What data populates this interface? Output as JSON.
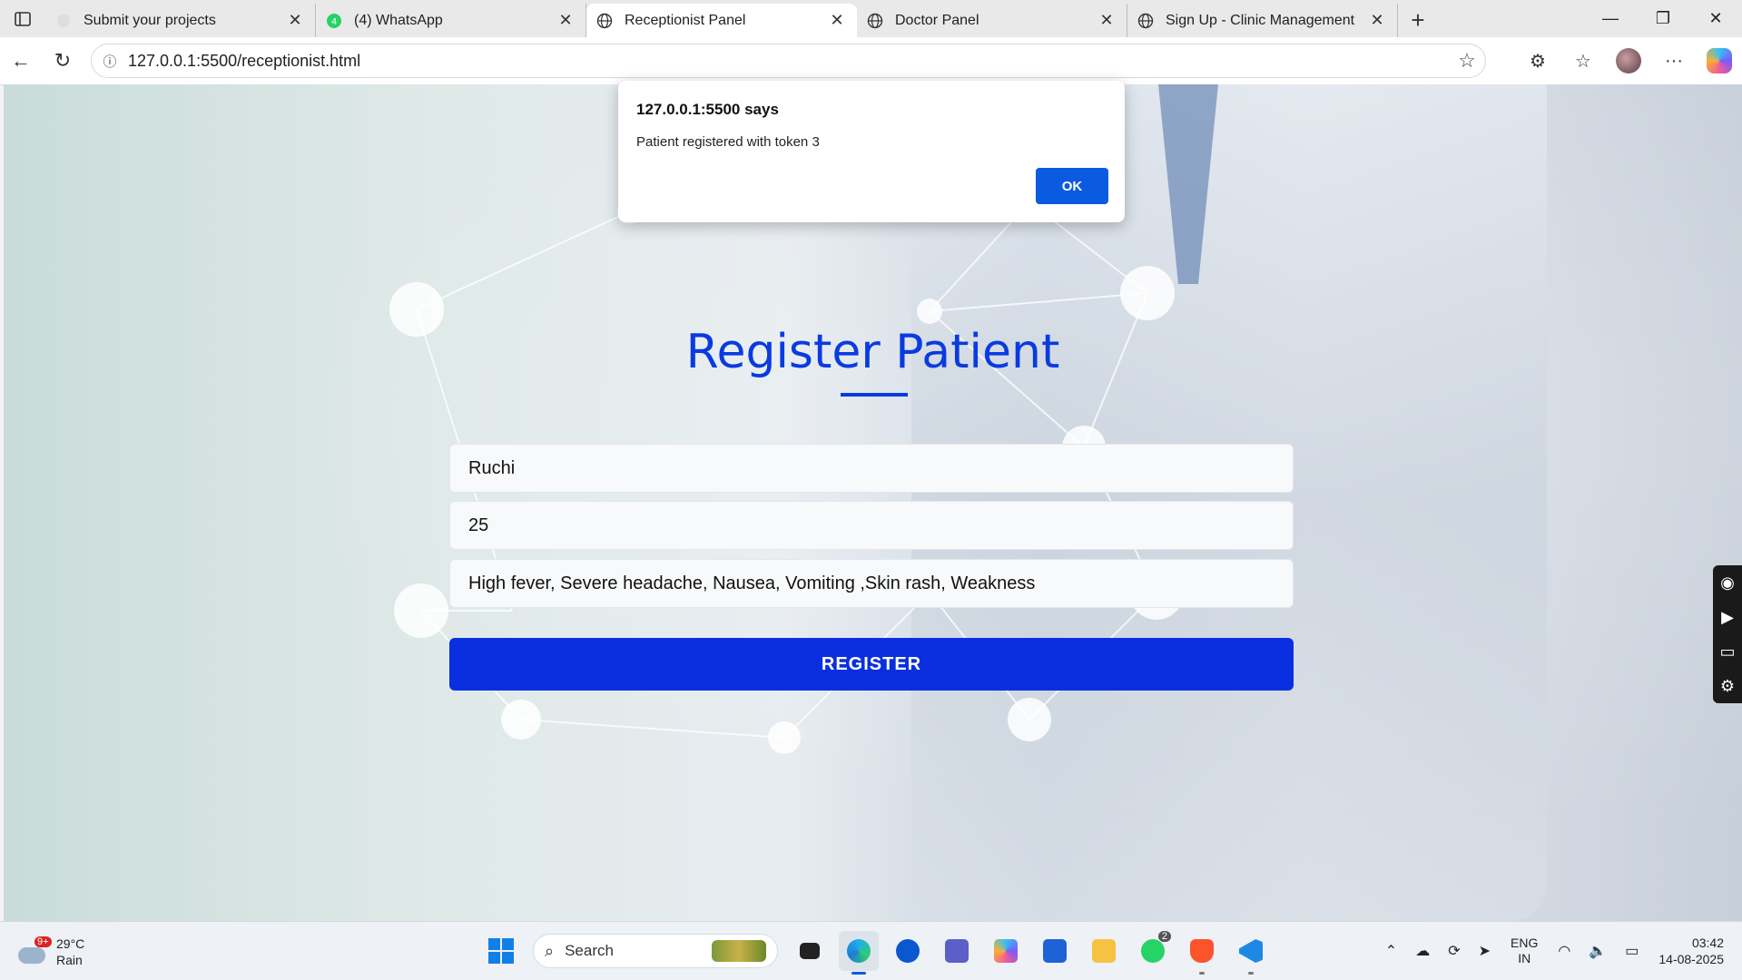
{
  "browser": {
    "tabs": [
      {
        "title": "Submit your projects",
        "active": false
      },
      {
        "title": "(4) WhatsApp",
        "active": false
      },
      {
        "title": "Receptionist Panel",
        "active": true
      },
      {
        "title": "Doctor Panel",
        "active": false
      },
      {
        "title": "Sign Up - Clinic Management",
        "active": false
      }
    ],
    "url": "127.0.0.1:5500/receptionist.html"
  },
  "alert": {
    "origin": "127.0.0.1:5500 says",
    "message": "Patient registered with token 3",
    "ok_label": "OK"
  },
  "form": {
    "heading": "Register Patient",
    "name_value": "Ruchi",
    "age_value": "25",
    "symptoms_value": "High fever, Severe headache, Nausea, Vomiting ,Skin rash, Weakness",
    "register_label": "REGISTER"
  },
  "taskbar": {
    "temperature": "29°C",
    "condition": "Rain",
    "weather_badge": "9+",
    "search_placeholder": "Search",
    "whatsapp_count": "2",
    "lang_top": "ENG",
    "lang_bottom": "IN",
    "time": "03:42",
    "date": "14-08-2025"
  },
  "colors": {
    "accent": "#0a3be0",
    "button": "#0a2fe0",
    "alert_ok": "#0a5be0"
  }
}
